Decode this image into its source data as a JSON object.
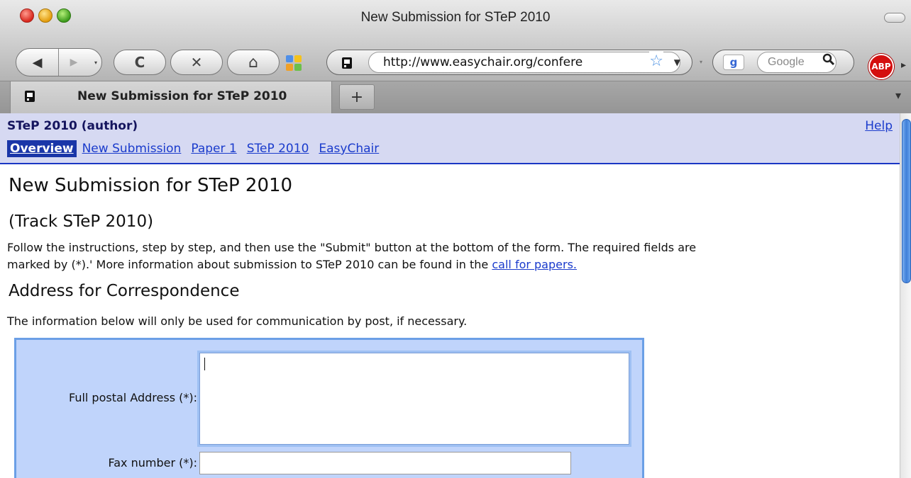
{
  "window": {
    "title": "New Submission for STeP 2010"
  },
  "toolbar": {
    "back_icon": "◀",
    "forward_icon": "▶",
    "dropdown_icon": "▾",
    "reload_icon": "C",
    "stop_icon": "✕",
    "home_icon": "⌂",
    "url": "http://www.easychair.org/confere",
    "bookmark_star": "☆",
    "url_dropdown": "▼",
    "search_placeholder": "Google",
    "search_engine_label": "g",
    "search_icon": "🔍",
    "adblock_label": "ABP",
    "overflow_icon": "▸"
  },
  "tabs": {
    "active_label": "New Submission for STeP 2010",
    "new_tab": "+"
  },
  "header": {
    "conference": "STeP 2010 (author)",
    "help": "Help",
    "menu": [
      {
        "label": "Overview",
        "active": true
      },
      {
        "label": "New Submission",
        "active": false
      },
      {
        "label": "Paper 1",
        "active": false
      },
      {
        "label": "STeP 2010",
        "active": false
      },
      {
        "label": "EasyChair",
        "active": false
      }
    ]
  },
  "page": {
    "title": "New Submission for STeP 2010",
    "track": "(Track STeP 2010)",
    "instructions_line1": "Follow the instructions, step by step, and then use the \"Submit\" button at the bottom of the form. The required fields are",
    "instructions_line2_prefix": "marked by (*).' More information about submission to STeP 2010 can be found in the ",
    "instructions_link": "call for papers.",
    "section_title": "Address for Correspondence",
    "section_info": "The information below will only be used for communication by post, if necessary."
  },
  "form": {
    "postal_label": "Full postal Address (*):",
    "postal_value": "",
    "fax_label": "Fax number (*):",
    "fax_value": ""
  },
  "colors": {
    "header_bg": "#d6d9f2",
    "link": "#1a3bcc",
    "form_bg": "#c0d4fb",
    "form_border": "#6b9fe6"
  }
}
